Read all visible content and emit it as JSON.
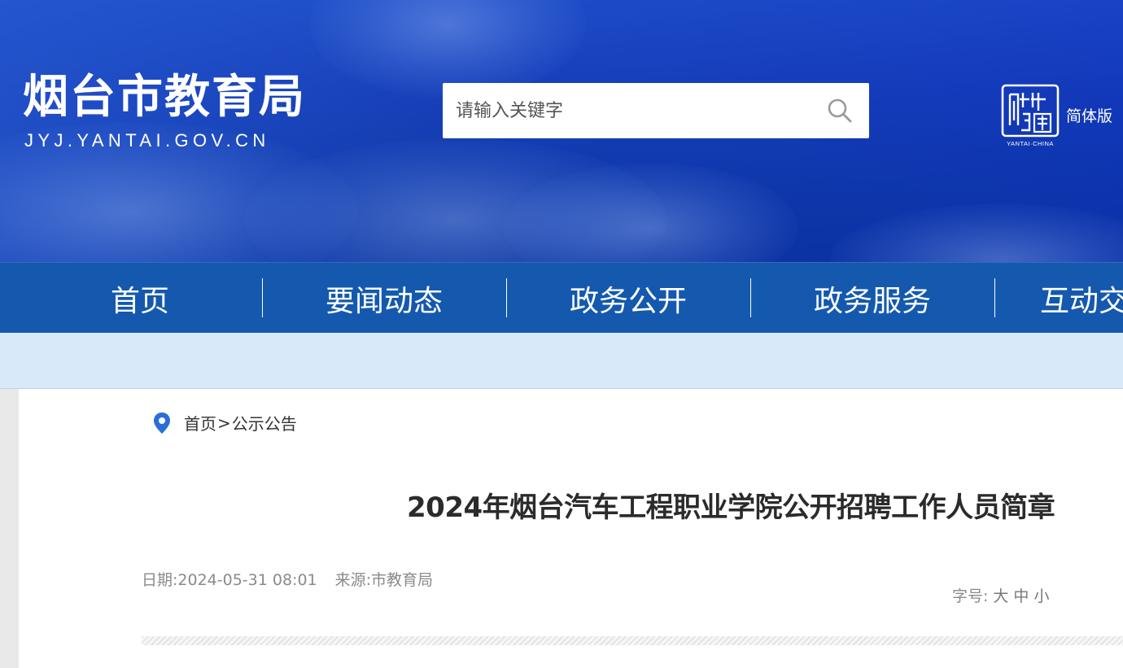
{
  "header": {
    "site_title": "烟台市教育局",
    "site_domain": "JYJ.YANTAI.GOV.CN",
    "search_placeholder": "请输入关键字",
    "seal_text": "YANTAI·CHINA",
    "language_link": "简体版"
  },
  "nav": {
    "items": [
      {
        "label": "首页"
      },
      {
        "label": "要闻动态"
      },
      {
        "label": "政务公开"
      },
      {
        "label": "政务服务"
      },
      {
        "label": "互动交"
      }
    ]
  },
  "breadcrumb": {
    "home": "首页",
    "separator": ">",
    "current": "公示公告"
  },
  "article": {
    "title": "2024年烟台汽车工程职业学院公开招聘工作人员简章",
    "date": "日期:2024-05-31 08:01",
    "source": "来源:市教育局",
    "font_size_label": "字号:",
    "font_size_options": [
      "大",
      "中",
      "小"
    ]
  },
  "colors": {
    "banner_blue": "#1640b9",
    "nav_blue": "#1459ad",
    "subbar": "#d8e9f9",
    "pin_blue": "#2a6fd6"
  }
}
